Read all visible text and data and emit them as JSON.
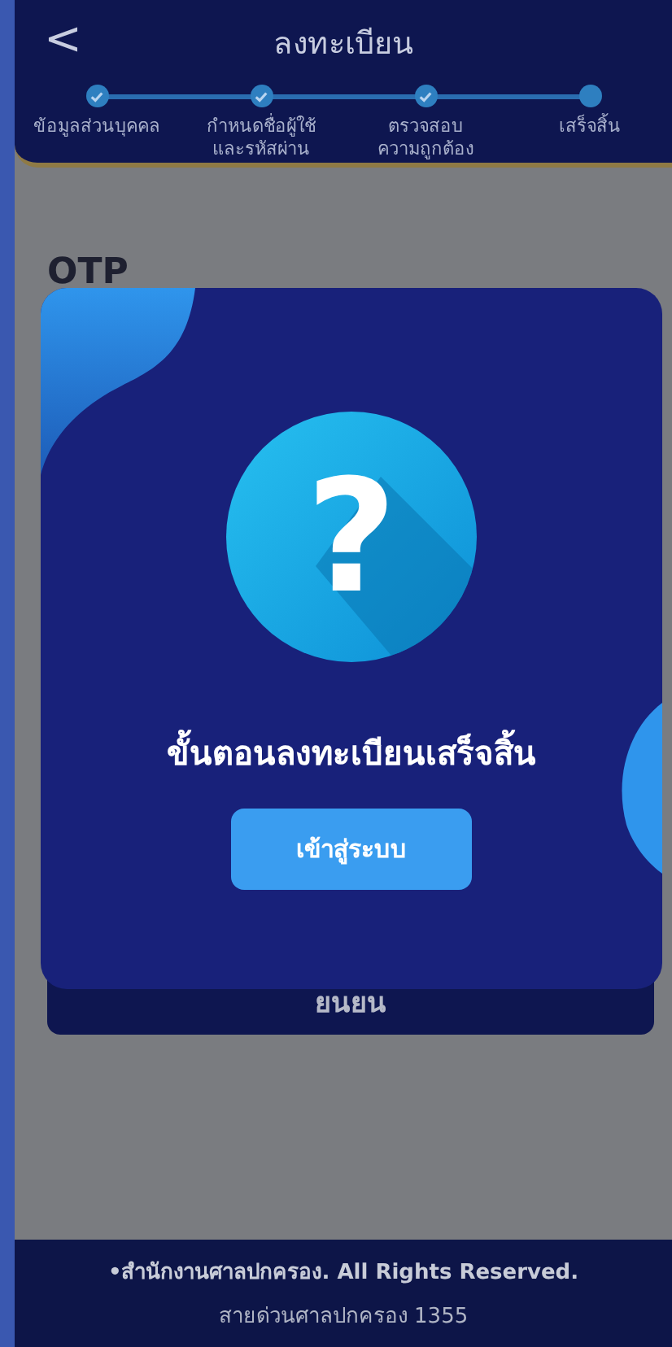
{
  "header": {
    "back": "<",
    "title": "ลงทะเบียน"
  },
  "steps": [
    {
      "label": "ข้อมูลส่วนบุคคล",
      "done": true
    },
    {
      "label": "กำหนดชื่อผู้ใช้\nและรหัสผ่าน",
      "done": true
    },
    {
      "label": "ตรวจสอบ\nความถูกต้อง",
      "done": true
    },
    {
      "label": "เสร็จสิ้น",
      "done": false
    }
  ],
  "form": {
    "label": "OTP",
    "confirm_button": "ยนยน"
  },
  "dialog": {
    "symbol": "?",
    "message": "ขั้นตอนลงทะเบียนเสร็จสิ้น",
    "button": "เข้าสู่ระบบ"
  },
  "footer": {
    "copyright": "•สำนักงานศาลปกครอง. All Rights Reserved.",
    "hotline": "สายด่วนศาลปกครอง 1355"
  }
}
